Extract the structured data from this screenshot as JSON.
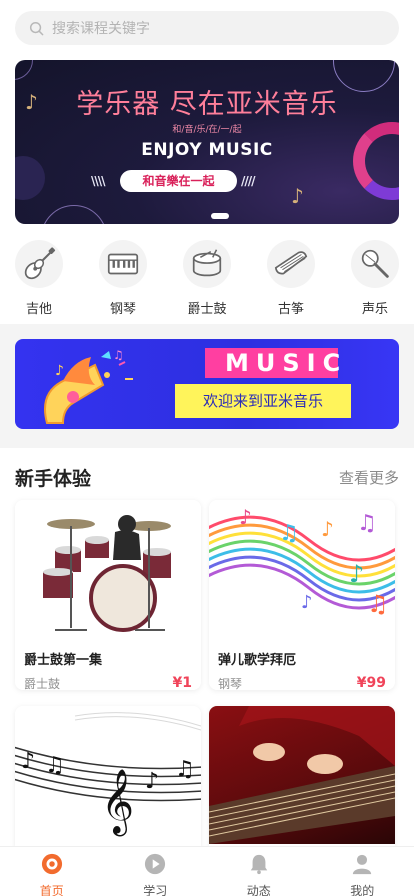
{
  "search": {
    "placeholder": "搜索课程关键字"
  },
  "banner": {
    "title": "学乐器 尽在亚米音乐",
    "subtitle": "和/音/乐/在/一/起",
    "english": "ENJOY MUSIC",
    "pill": "和音樂在一起",
    "stripes_left": "\\\\\\\\",
    "stripes_right": "////"
  },
  "categories": [
    {
      "label": "吉他",
      "icon": "guitar-icon"
    },
    {
      "label": "钢琴",
      "icon": "piano-icon"
    },
    {
      "label": "爵士鼓",
      "icon": "drum-icon"
    },
    {
      "label": "古筝",
      "icon": "guzheng-icon"
    },
    {
      "label": "声乐",
      "icon": "microphone-icon"
    }
  ],
  "promo": {
    "music": "MUSIC",
    "welcome": "欢迎来到亚米音乐"
  },
  "section": {
    "title": "新手体验",
    "more": "查看更多"
  },
  "courses": [
    {
      "title": "爵士鼓第一集",
      "tag": "爵士鼓",
      "price": "¥1"
    },
    {
      "title": "弹儿歌学拜厄",
      "tag": "钢琴",
      "price": "¥99"
    },
    {
      "title": "",
      "tag": "",
      "price": ""
    },
    {
      "title": "",
      "tag": "",
      "price": ""
    }
  ],
  "tabs": [
    {
      "label": "首页",
      "icon": "home-icon",
      "active": true
    },
    {
      "label": "学习",
      "icon": "play-icon",
      "active": false
    },
    {
      "label": "动态",
      "icon": "bell-icon",
      "active": false
    },
    {
      "label": "我的",
      "icon": "user-icon",
      "active": false
    }
  ],
  "colors": {
    "accent": "#f26b2e",
    "price": "#f0445a",
    "promo_blue": "#3433f0",
    "promo_pink": "#ff3fa1",
    "promo_yellow": "#fff45b"
  }
}
